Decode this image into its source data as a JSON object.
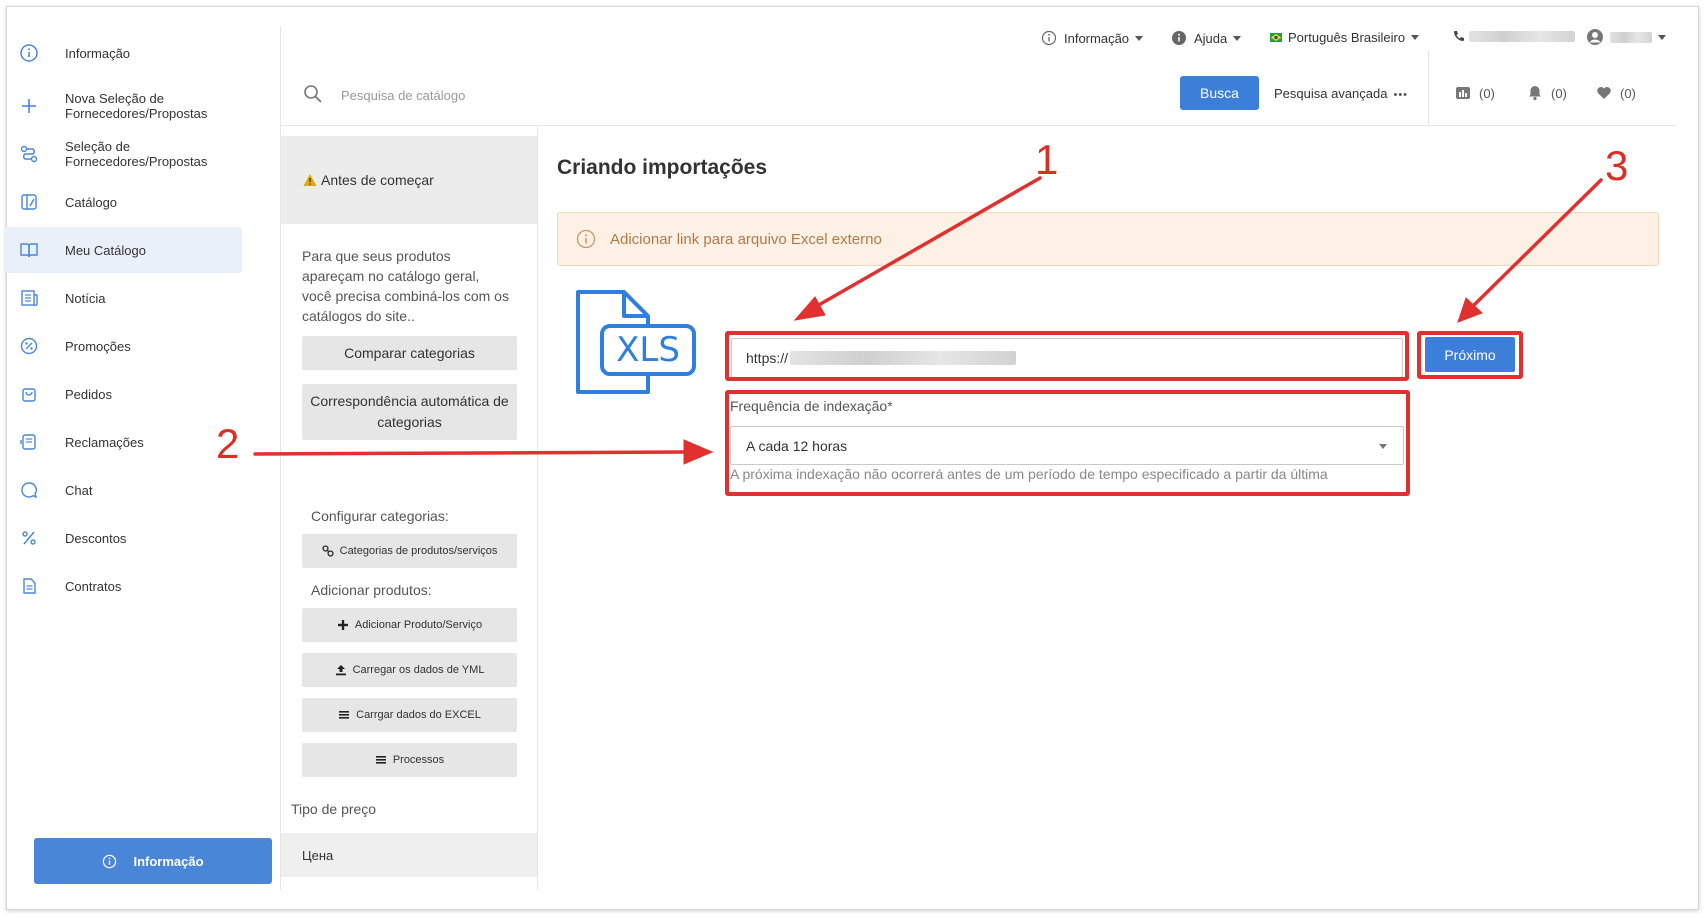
{
  "sidebar": {
    "items": [
      {
        "label": "Informação",
        "icon": "info-icon"
      },
      {
        "label": "Nova Seleção de\nFornecedores/Propostas",
        "icon": "plus-icon"
      },
      {
        "label": "Seleção de\nFornecedores/Propostas",
        "icon": "route-icon"
      },
      {
        "label": "Catálogo",
        "icon": "catalog-icon"
      },
      {
        "label": "Meu Catálogo",
        "icon": "book-icon",
        "active": true
      },
      {
        "label": "Notícia",
        "icon": "news-icon"
      },
      {
        "label": "Promoções",
        "icon": "percent-badge-icon"
      },
      {
        "label": "Pedidos",
        "icon": "bag-icon"
      },
      {
        "label": "Reclamações",
        "icon": "complaint-icon"
      },
      {
        "label": "Chat",
        "icon": "chat-icon"
      },
      {
        "label": "Descontos",
        "icon": "percent-icon"
      },
      {
        "label": "Contratos",
        "icon": "document-icon"
      }
    ],
    "info_button": "Informação"
  },
  "topbar": {
    "info_menu": "Informação",
    "help_menu": "Ajuda",
    "language": "Português Brasileiro",
    "search_placeholder": "Pesquisa de catálogo",
    "search_button": "Busca",
    "advanced_search": "Pesquisa avançada",
    "advanced_dots": "•••",
    "compare_count": "(0)",
    "notifications_count": "(0)",
    "favorites_count": "(0)"
  },
  "middle": {
    "warning": "Antes de começar",
    "description": "Para que seus produtos apareçam no catálogo geral, você precisa combiná-los com os catálogos do site..",
    "compare_categories": "Comparar categorias",
    "auto_match": "Correspondência automática de categorias",
    "configure_label": "Configurar categorias:",
    "product_categories": "Categorias de produtos/serviços",
    "add_products_label": "Adicionar produtos:",
    "add_product": "Adicionar Produto/Serviço",
    "upload_yml": "Carregar os dados de YML",
    "upload_excel": "Carrgar dados do EXCEL",
    "processes": "Processos",
    "price_type_label": "Tipo de preço",
    "price_type_value": "Цена"
  },
  "main": {
    "title": "Criando importações",
    "alert_text": "Adicionar link para arquivo Excel externo",
    "file_icon_text": "XLS",
    "url_value": "https://",
    "next_button": "Próximo",
    "frequency_label": "Frequência de indexação*",
    "frequency_value": "A cada 12 horas",
    "frequency_hint": "A próxima indexação não ocorrerá antes de um período de tempo especificado a partir da última"
  },
  "annotations": {
    "label_1": "1",
    "label_2": "2",
    "label_3": "3"
  },
  "colors": {
    "primary": "#3c7fd9",
    "annotation": "#e03030",
    "alert_bg": "#fdf1e6",
    "alert_text": "#b07a45"
  }
}
